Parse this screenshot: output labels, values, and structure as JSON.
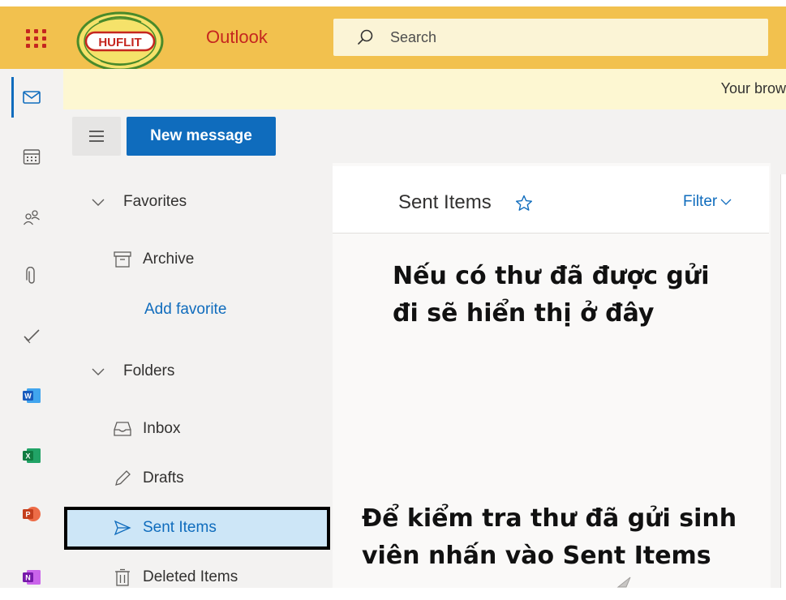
{
  "header": {
    "app_name": "Outlook",
    "logo_text": "HUFLIT",
    "search_placeholder": "Search"
  },
  "banner": {
    "text": "Your brow"
  },
  "toolbar": {
    "new_message_label": "New message",
    "right_glyph": "&#x2571;"
  },
  "rail": [
    "mail-icon",
    "calendar-icon",
    "people-icon",
    "attachment-icon",
    "todo-icon",
    "word-icon",
    "excel-icon",
    "powerpoint-icon",
    "onenote-icon"
  ],
  "folders": {
    "favorites_label": "Favorites",
    "archive_label": "Archive",
    "add_favorite_label": "Add favorite",
    "folders_label": "Folders",
    "inbox_label": "Inbox",
    "drafts_label": "Drafts",
    "sent_items_label": "Sent Items",
    "deleted_items_label": "Deleted Items"
  },
  "list": {
    "title": "Sent Items",
    "filter_label": "Filter"
  },
  "annotations": {
    "top_line1": "Nếu có thư đã được gửi",
    "top_line2": "đi sẽ hiển thị ở đây",
    "bottom_line1": "Để kiểm tra thư đã gửi sinh",
    "bottom_line2": "viên nhấn vào Sent Items"
  },
  "colors": {
    "header_bg": "#f2c14e",
    "accent_red": "#c5261f",
    "brand_blue": "#0f6cbd",
    "selected_bg": "#cde6f7"
  }
}
